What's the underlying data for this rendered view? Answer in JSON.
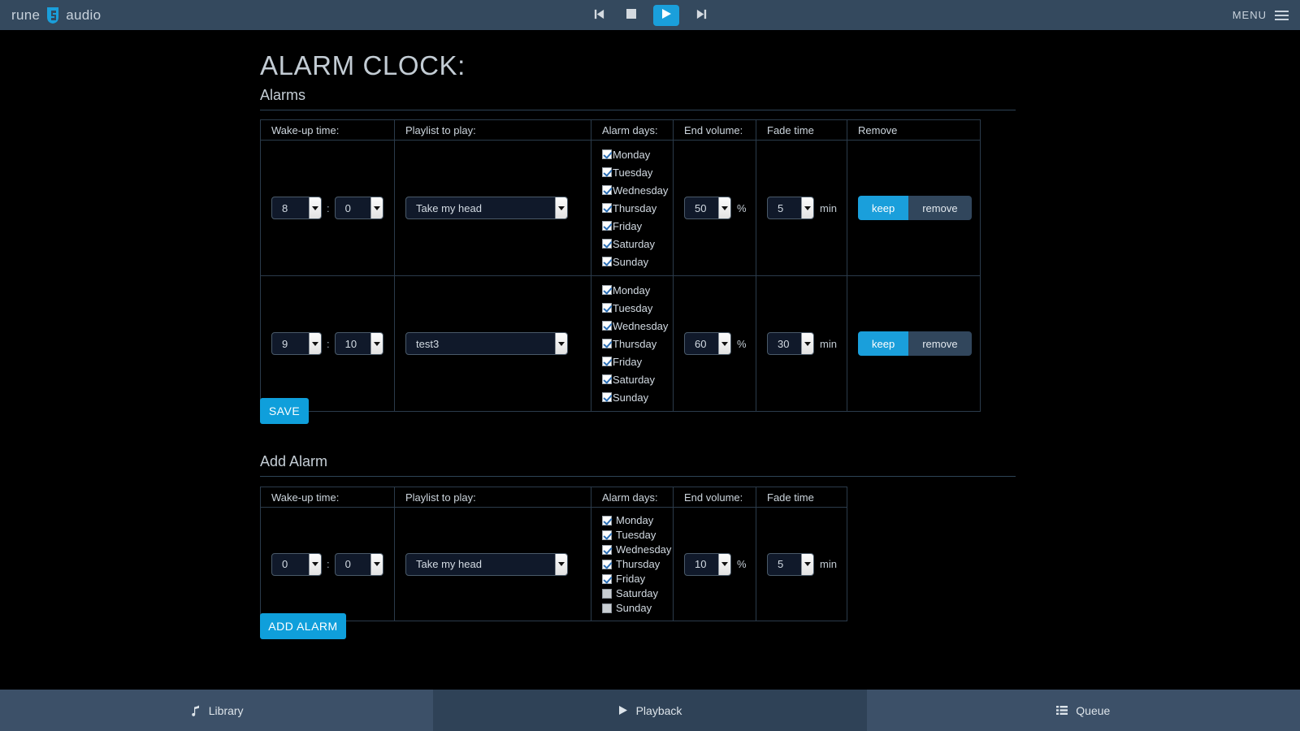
{
  "header": {
    "brand_rune": "rune",
    "brand_audio": "audio",
    "brand_logo_icon": "rune-logo-icon",
    "controls": [
      {
        "name": "previous-button",
        "icon": "skip-previous-icon",
        "active": false
      },
      {
        "name": "stop-button",
        "icon": "stop-icon",
        "active": false
      },
      {
        "name": "play-button",
        "icon": "play-icon",
        "active": true
      },
      {
        "name": "next-button",
        "icon": "skip-next-icon",
        "active": false
      }
    ],
    "menu_label": "MENU",
    "menu_icon": "hamburger-icon"
  },
  "page": {
    "title": "ALARM CLOCK:",
    "sections": {
      "alarms": "Alarms",
      "add_alarm": "Add Alarm"
    }
  },
  "alarms_table": {
    "columns": [
      "Wake-up time:",
      "Playlist to play:",
      "Alarm days:",
      "End volume:",
      "Fade time",
      "Remove"
    ],
    "units": {
      "volume": "%",
      "fade": "min",
      "time_separator": ":"
    },
    "toggle": {
      "keep": "keep",
      "remove": "remove"
    },
    "rows": [
      {
        "hour": "8",
        "minute": "0",
        "playlist": "Take my head",
        "days": [
          {
            "label": "Monday",
            "checked": true
          },
          {
            "label": "Tuesday",
            "checked": true
          },
          {
            "label": "Wednesday",
            "checked": true
          },
          {
            "label": "Thursday",
            "checked": true
          },
          {
            "label": "Friday",
            "checked": true
          },
          {
            "label": "Saturday",
            "checked": true
          },
          {
            "label": "Sunday",
            "checked": true
          }
        ],
        "end_volume": "50",
        "fade_time": "5",
        "remove_state": "keep"
      },
      {
        "hour": "9",
        "minute": "10",
        "playlist": "test3",
        "days": [
          {
            "label": "Monday",
            "checked": true
          },
          {
            "label": "Tuesday",
            "checked": true
          },
          {
            "label": "Wednesday",
            "checked": true
          },
          {
            "label": "Thursday",
            "checked": true
          },
          {
            "label": "Friday",
            "checked": true
          },
          {
            "label": "Saturday",
            "checked": true
          },
          {
            "label": "Sunday",
            "checked": true
          }
        ],
        "end_volume": "60",
        "fade_time": "30",
        "remove_state": "keep"
      }
    ],
    "save_label": "SAVE"
  },
  "add_alarm_table": {
    "columns": [
      "Wake-up time:",
      "Playlist to play:",
      "Alarm days:",
      "End volume:",
      "Fade time"
    ],
    "units": {
      "volume": "%",
      "fade": "min",
      "time_separator": ":"
    },
    "row": {
      "hour": "0",
      "minute": "0",
      "playlist": "Take my head",
      "days": [
        {
          "label": "Monday",
          "checked": true
        },
        {
          "label": "Tuesday",
          "checked": true
        },
        {
          "label": "Wednesday",
          "checked": true
        },
        {
          "label": "Thursday",
          "checked": true
        },
        {
          "label": "Friday",
          "checked": true
        },
        {
          "label": "Saturday",
          "checked": false
        },
        {
          "label": "Sunday",
          "checked": false
        }
      ],
      "end_volume": "10",
      "fade_time": "5"
    },
    "add_label": "ADD ALARM"
  },
  "bottom_nav": [
    {
      "label": "Library",
      "icon": "music-note-icon",
      "active": false
    },
    {
      "label": "Playback",
      "icon": "play-triangle-icon",
      "active": true
    },
    {
      "label": "Queue",
      "icon": "list-icon",
      "active": false
    }
  ],
  "colors": {
    "accent": "#1a9fdb",
    "topbar": "#34495e",
    "navbar": "#3c5068",
    "nav_active": "#2f4257",
    "background": "#000000",
    "toggle_inactive": "#31465c"
  }
}
